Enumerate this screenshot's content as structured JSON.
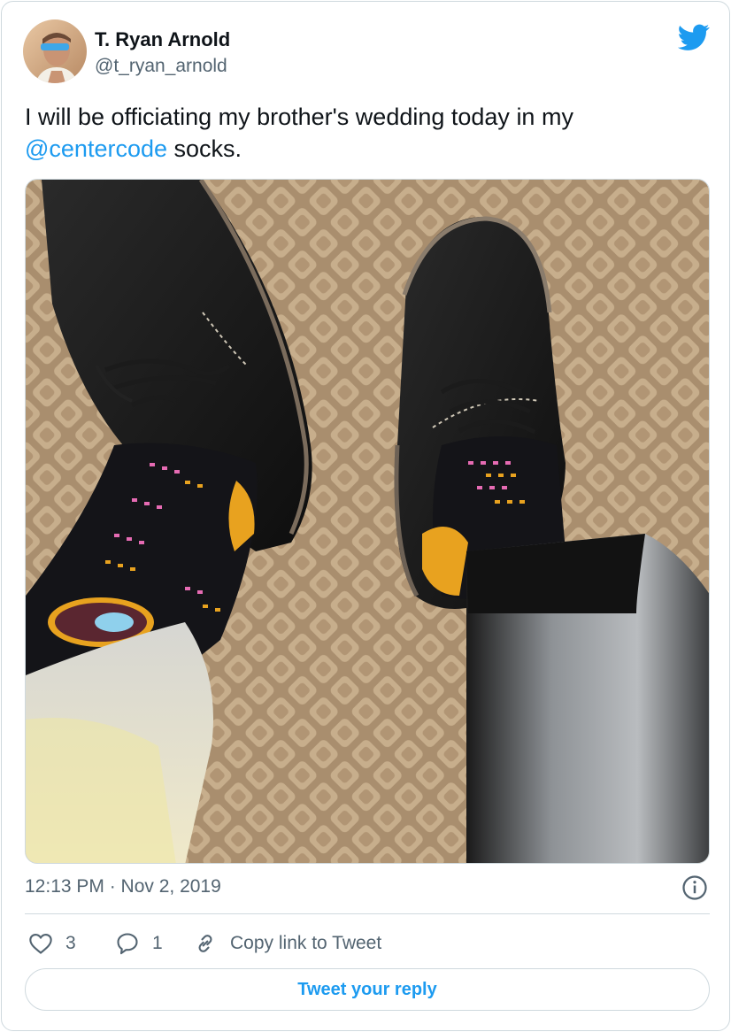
{
  "author": {
    "name": "T. Ryan Arnold",
    "handle": "@t_ryan_arnold"
  },
  "tweet": {
    "text_before": "I will be officiating my brother's wedding today in my ",
    "mention": "@centercode",
    "text_after": " socks."
  },
  "meta": {
    "timestamp": "12:13 PM · Nov 2, 2019"
  },
  "actions": {
    "likes": "3",
    "replies": "1",
    "copy_link_label": "Copy link to Tweet"
  },
  "reply_button": {
    "label": "Tweet your reply"
  },
  "colors": {
    "accent": "#1d9bf0",
    "text": "#0f1419",
    "secondary": "#536471",
    "border": "#cfd9de"
  },
  "icons": {
    "brand": "twitter-bird-icon",
    "info": "info-icon",
    "like": "heart-icon",
    "reply": "speech-bubble-icon",
    "link": "link-icon"
  }
}
